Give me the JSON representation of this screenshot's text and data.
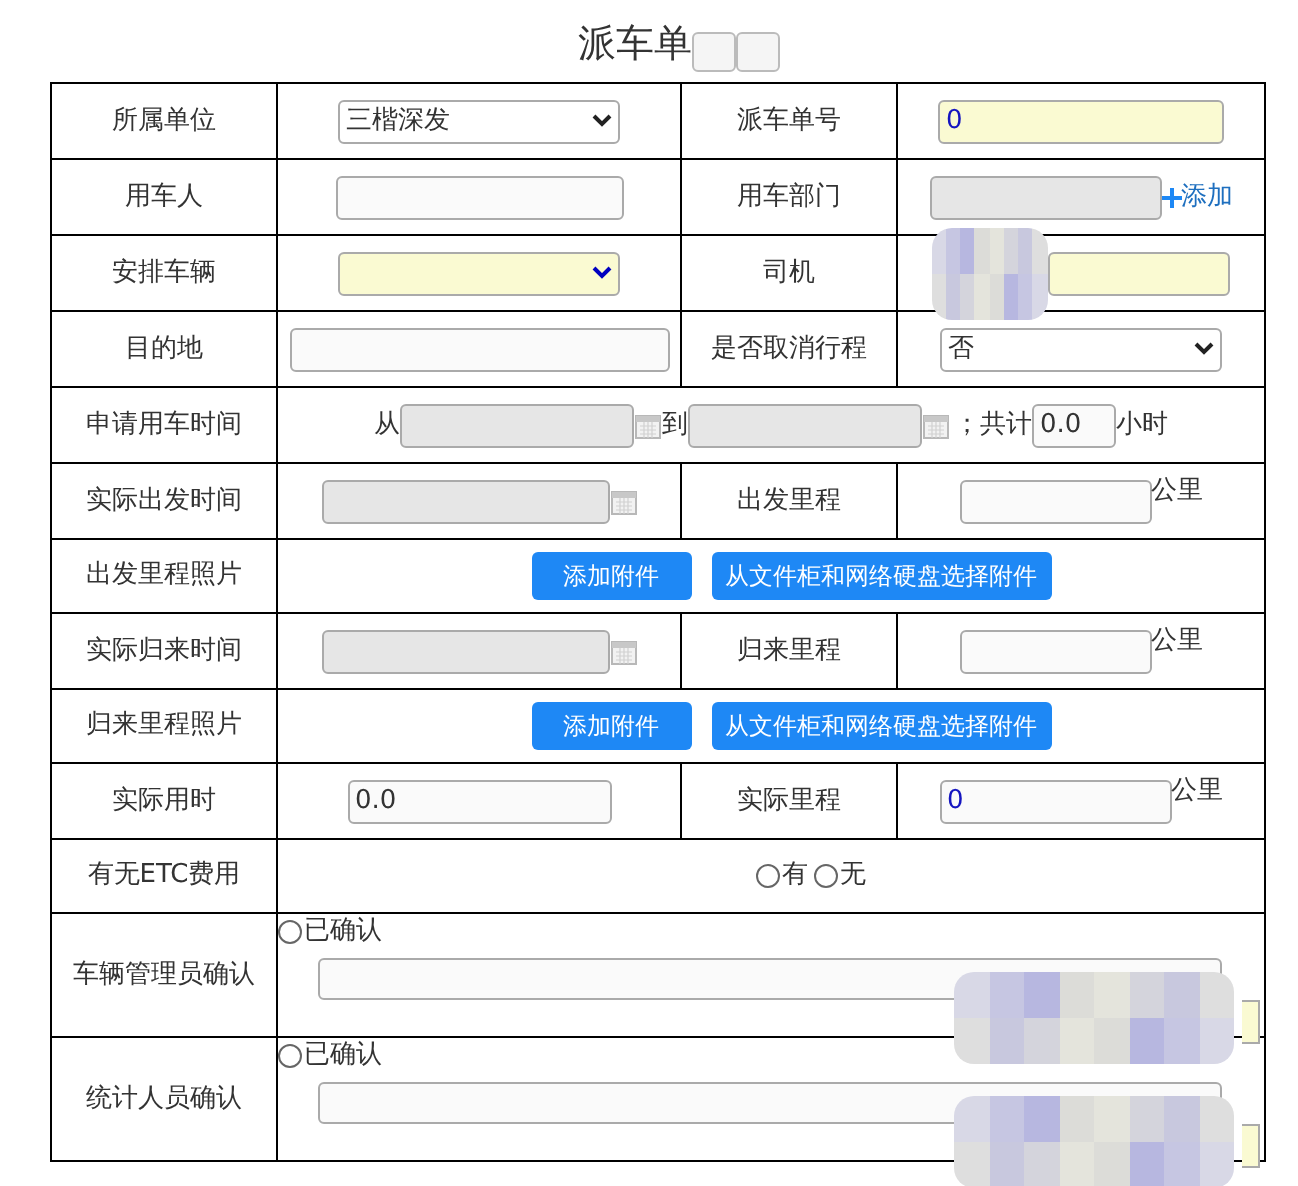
{
  "title": "派车单",
  "rows": [
    {
      "kind": "pair",
      "cells": [
        {
          "label": "所属单位",
          "field": {
            "kind": "select",
            "value": "三楷深发",
            "highlight": false
          }
        },
        {
          "label": "派车单号",
          "field": {
            "kind": "input",
            "value": "0",
            "highlight": true
          }
        }
      ]
    },
    {
      "kind": "pair",
      "cells": [
        {
          "label": "用车人",
          "field": {
            "kind": "input",
            "highlight": false
          }
        },
        {
          "label": "用车部门",
          "field": {
            "kind": "readonly",
            "link": "添加"
          }
        }
      ]
    },
    {
      "kind": "pair",
      "cells": [
        {
          "label": "安排车辆",
          "field": {
            "kind": "select",
            "highlight": true
          }
        },
        {
          "label": "司机",
          "field": {
            "kind": "masked_input",
            "highlight": true
          }
        }
      ]
    },
    {
      "kind": "pair",
      "cells": [
        {
          "label": "目的地",
          "field": {
            "kind": "input",
            "highlight": false
          }
        },
        {
          "label": "是否取消行程",
          "field": {
            "kind": "select",
            "value": "否",
            "highlight": false
          }
        }
      ]
    },
    {
      "kind": "time_range",
      "label": "申请用车时间",
      "from": "从",
      "to": "到",
      "total": "；共计",
      "hours": "0.0",
      "unit": "小时"
    },
    {
      "kind": "pair",
      "cells": [
        {
          "label": "实际出发时间",
          "field": {
            "kind": "date"
          }
        },
        {
          "label": "出发里程",
          "field": {
            "kind": "input",
            "highlight": false,
            "suffix": "公里"
          }
        }
      ]
    },
    {
      "kind": "attachments",
      "label": "出发里程照片",
      "buttons": [
        "添加附件",
        "从文件柜和网络硬盘选择附件"
      ]
    },
    {
      "kind": "pair",
      "cells": [
        {
          "label": "实际归来时间",
          "field": {
            "kind": "date"
          }
        },
        {
          "label": "归来里程",
          "field": {
            "kind": "input",
            "highlight": false,
            "suffix": "公里"
          }
        }
      ]
    },
    {
      "kind": "attachments",
      "label": "归来里程照片",
      "buttons": [
        "添加附件",
        "从文件柜和网络硬盘选择附件"
      ]
    },
    {
      "kind": "pair",
      "cells": [
        {
          "label": "实际用时",
          "field": {
            "kind": "input",
            "value": "0.0",
            "highlight": false
          }
        },
        {
          "label": "实际里程",
          "field": {
            "kind": "input",
            "value": "0",
            "highlight": false,
            "suffix": "公里"
          }
        }
      ]
    },
    {
      "kind": "radio",
      "label": "有无ETC费用",
      "options": [
        {
          "label": "有",
          "selected": false
        },
        {
          "label": "无",
          "selected": false
        }
      ]
    },
    {
      "kind": "confirm",
      "label": "车辆管理员确认",
      "option": {
        "label": "已确认",
        "selected": false
      }
    },
    {
      "kind": "confirm",
      "label": "统计人员确认",
      "option": {
        "label": "已确认",
        "selected": false
      }
    }
  ]
}
